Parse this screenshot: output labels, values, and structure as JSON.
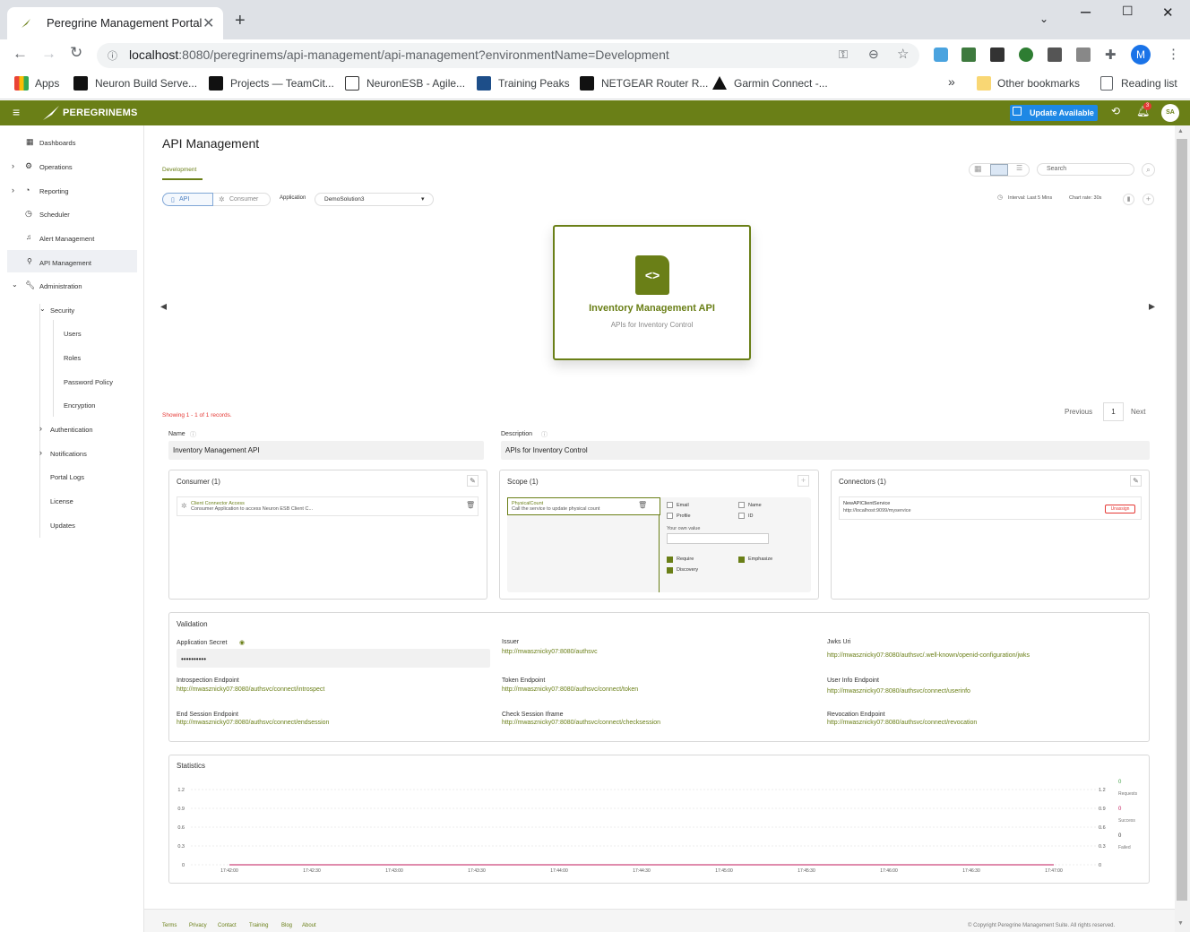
{
  "browser": {
    "tab_title": "Peregrine Management Portal",
    "url_host": "localhost",
    "url_rest": ":8080/peregrinems/api-management/api-management?environmentName=Development",
    "profile_initial": "M",
    "bookmarks": [
      "Apps",
      "Neuron Build Serve...",
      "Projects — TeamCit...",
      "NeuronESB - Agile...",
      "Training Peaks",
      "NETGEAR Router R...",
      "Garmin Connect -..."
    ],
    "other_bookmarks": "Other bookmarks",
    "reading_list": "Reading list"
  },
  "header": {
    "logo": "PEREGRINEMS",
    "update_label": "Update Available",
    "notification_count": "3",
    "avatar": "SA"
  },
  "sidebar": {
    "items": [
      "Dashboards",
      "Operations",
      "Reporting",
      "Scheduler",
      "Alert Management",
      "API Management",
      "Administration",
      "Security",
      "Users",
      "Roles",
      "Password Policy",
      "Encryption",
      "Authentication",
      "Notifications",
      "Portal Logs",
      "License",
      "Updates"
    ]
  },
  "page": {
    "title": "API Management",
    "env_tab": "Development",
    "search_placeholder": "Search",
    "toggle_api": "API",
    "toggle_consumer": "Consumer",
    "application_label": "Application",
    "application_value": "DemoSolution3",
    "interval": "Interval: Last 5 Mins",
    "chart_rate": "Chart rate: 30s",
    "card_title": "Inventory Management API",
    "card_subtitle": "APIs for Inventory Control",
    "showing": "Showing 1 - 1 of 1 records.",
    "prev": "Previous",
    "page_num": "1",
    "next": "Next",
    "name_label": "Name",
    "name_value": "Inventory Management API",
    "desc_label": "Description",
    "desc_value": "APIs for Inventory Control"
  },
  "consumer": {
    "title": "Consumer (1)",
    "item_name": "Client Connector Access",
    "item_desc": "Consumer Application to access Neuron ESB Client C..."
  },
  "scope": {
    "title": "Scope (1)",
    "item_name": "PhysicalCount",
    "item_desc": "Call the service to update physical count",
    "email": "Email",
    "name": "Name",
    "profile": "Profile",
    "id": "ID",
    "own_value": "Your own value",
    "require": "Require",
    "emphasize": "Emphasize",
    "discovery": "Discovery"
  },
  "connectors": {
    "title": "Connectors (1)",
    "item_name": "NewAPIClientService",
    "item_url": "http://localhost:9099/myservice",
    "unassign": "Unassign"
  },
  "validation": {
    "title": "Validation",
    "secret_label": "Application Secret",
    "secret_value": "••••••••••",
    "issuer_label": "Issuer",
    "issuer": "http://mwasznicky07:8080/authsvc",
    "jwks_label": "Jwks Uri",
    "jwks": "http://mwasznicky07:8080/authsvc/.well-known/openid-configuration/jwks",
    "introspection_label": "Introspection Endpoint",
    "introspection": "http://mwasznicky07:8080/authsvc/connect/introspect",
    "token_label": "Token Endpoint",
    "token": "http://mwasznicky07:8080/authsvc/connect/token",
    "userinfo_label": "User Info Endpoint",
    "userinfo": "http://mwasznicky07:8080/authsvc/connect/userinfo",
    "endsession_label": "End Session Endpoint",
    "endsession": "http://mwasznicky07:8080/authsvc/connect/endsession",
    "checksession_label": "Check Session Iframe",
    "checksession": "http://mwasznicky07:8080/authsvc/connect/checksession",
    "revocation_label": "Revocation Endpoint",
    "revocation": "http://mwasznicky07:8080/authsvc/connect/revocation"
  },
  "statistics": {
    "title": "Statistics",
    "legend": [
      {
        "count": "0",
        "label": "Requests",
        "color": "#e53935"
      },
      {
        "count": "0",
        "label": "Success",
        "color": "#43a047"
      },
      {
        "count": "0",
        "label": "Failed",
        "color": "#c2185b"
      }
    ]
  },
  "chart_data": {
    "type": "line",
    "x": [
      "17:42:00",
      "17:42:30",
      "17:43:00",
      "17:43:30",
      "17:44:00",
      "17:44:30",
      "17:45:00",
      "17:45:30",
      "17:46:00",
      "17:46:30",
      "17:47:00"
    ],
    "y_ticks": [
      "1.2",
      "0.9",
      "0.6",
      "0.3",
      "0"
    ],
    "ylim": [
      0,
      1.2
    ],
    "series": [
      {
        "name": "Requests",
        "values": [
          0,
          0,
          0,
          0,
          0,
          0,
          0,
          0,
          0,
          0,
          0
        ],
        "color": "#e53935"
      },
      {
        "name": "Success",
        "values": [
          0,
          0,
          0,
          0,
          0,
          0,
          0,
          0,
          0,
          0,
          0
        ],
        "color": "#43a047"
      },
      {
        "name": "Failed",
        "values": [
          0,
          0,
          0,
          0,
          0,
          0,
          0,
          0,
          0,
          0,
          0
        ],
        "color": "#c2185b"
      }
    ]
  },
  "footer": {
    "links": [
      "Terms",
      "Privacy",
      "Contact",
      "Training",
      "Blog",
      "About"
    ],
    "copyright": "© Copyright Peregrine Management Suite. All rights reserved."
  }
}
